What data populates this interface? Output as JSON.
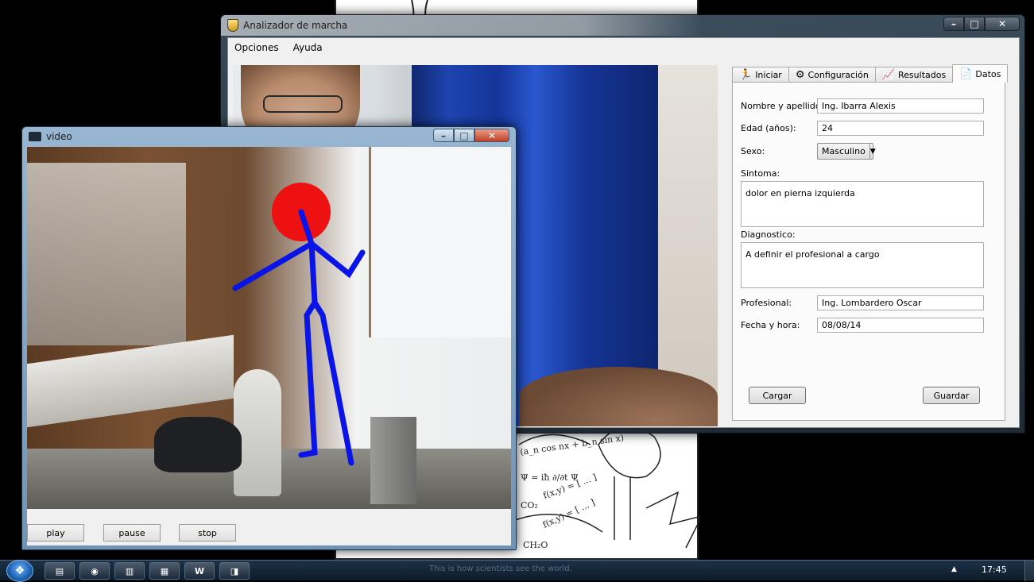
{
  "main_window": {
    "title": "Analizador de marcha",
    "menu": [
      "Opciones",
      "Ayuda"
    ],
    "controls": {
      "minimize": "–",
      "maximize": "□",
      "close": "✕"
    },
    "tabs": [
      {
        "label": "Iniciar",
        "icon": "runner-icon"
      },
      {
        "label": "Configuración",
        "icon": "gear-icon"
      },
      {
        "label": "Resultados",
        "icon": "chart-icon"
      },
      {
        "label": "Datos",
        "icon": "document-icon",
        "active": true
      }
    ],
    "form": {
      "name_label": "Nombre y apellido:",
      "name_value": "Ing. Ibarra Alexis",
      "age_label": "Edad (años):",
      "age_value": "24",
      "sex_label": "Sexo:",
      "sex_value": "Masculino",
      "symptom_label": "Sintoma:",
      "symptom_value": "dolor en pierna izquierda",
      "diagnosis_label": "Diagnostico:",
      "diagnosis_value": "A definir el profesional a cargo",
      "professional_label": "Profesional:",
      "professional_value": "Ing. Lombardero Oscar",
      "date_label": "Fecha y hora:",
      "date_value": "08/08/14"
    },
    "buttons": {
      "load": "Cargar",
      "save": "Guardar"
    }
  },
  "video_window": {
    "title": "video",
    "controls": {
      "minimize": "–",
      "maximize": "□",
      "close": "✕"
    },
    "buttons": {
      "play": "play",
      "pause": "pause",
      "stop": "stop"
    }
  },
  "taskbar": {
    "start_icon": "windows-logo-icon",
    "items": [
      {
        "name": "explorer",
        "glyph": "▤"
      },
      {
        "name": "chrome",
        "glyph": "◉"
      },
      {
        "name": "files",
        "glyph": "▥"
      },
      {
        "name": "app",
        "glyph": "▦"
      },
      {
        "name": "word",
        "glyph": "W"
      },
      {
        "name": "gait-analyzer",
        "glyph": "◨"
      }
    ],
    "wallpaper_caption": "This is how scientists see the world.",
    "tray_arrow": "▲",
    "clock": "17:45"
  },
  "colors": {
    "skeleton_blue": "#0a14e6",
    "head_red": "#ee1111",
    "curtain_blue": "#1e44b0"
  }
}
